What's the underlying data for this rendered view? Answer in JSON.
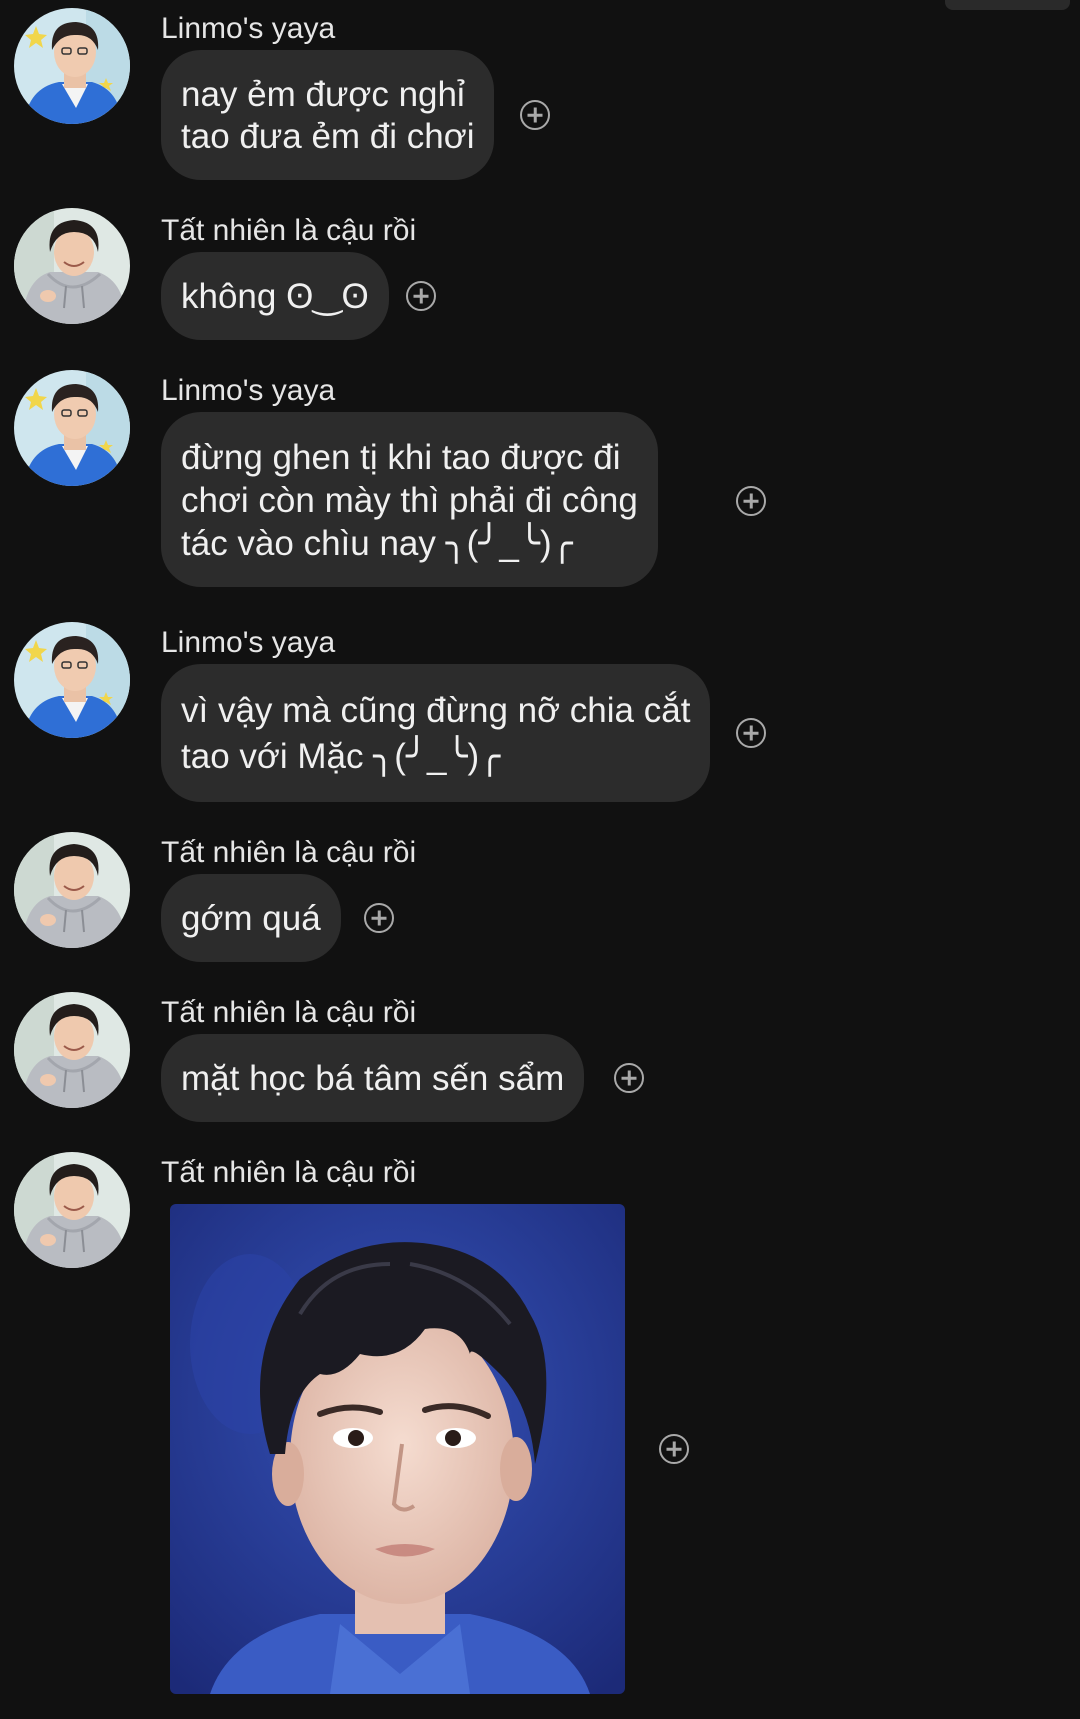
{
  "messages": [
    {
      "sender": "Linmo's yaya",
      "avatar": "avatar-blue-jacket",
      "lines": [
        "nay ẻm được nghỉ",
        "tao đưa ẻm đi chơi"
      ]
    },
    {
      "sender": "Tất nhiên là cậu rồi",
      "avatar": "avatar-grey-hoodie",
      "lines": [
        "không ʘ‿ʘ"
      ]
    },
    {
      "sender": "Linmo's yaya",
      "avatar": "avatar-blue-jacket",
      "lines": [
        "đừng ghen tị khi tao được đi",
        "chơi còn mày thì phải đi công",
        "tác vào chìu nay ╮(╯_╰)╭"
      ]
    },
    {
      "sender": "Linmo's yaya",
      "avatar": "avatar-blue-jacket",
      "lines": [
        "vì vậy mà cũng đừng nỡ chia cắt",
        "tao với Mặc ╮(╯_╰)╭"
      ]
    },
    {
      "sender": "Tất nhiên là cậu rồi",
      "avatar": "avatar-grey-hoodie",
      "lines": [
        "gớm quá"
      ]
    },
    {
      "sender": "Tất nhiên là cậu rồi",
      "avatar": "avatar-grey-hoodie",
      "lines": [
        "mặt học bá tâm sến sẩm"
      ]
    },
    {
      "sender": "Tất nhiên là cậu rồi",
      "avatar": "avatar-grey-hoodie",
      "image": "portrait-photo"
    }
  ],
  "icons": {
    "react": "add-reaction-icon"
  },
  "colors": {
    "background": "#111111",
    "bubble": "#2c2c2c",
    "text": "#f0f0f0",
    "sender": "#e6e6e6",
    "react_icon": "#a9a9a9"
  }
}
